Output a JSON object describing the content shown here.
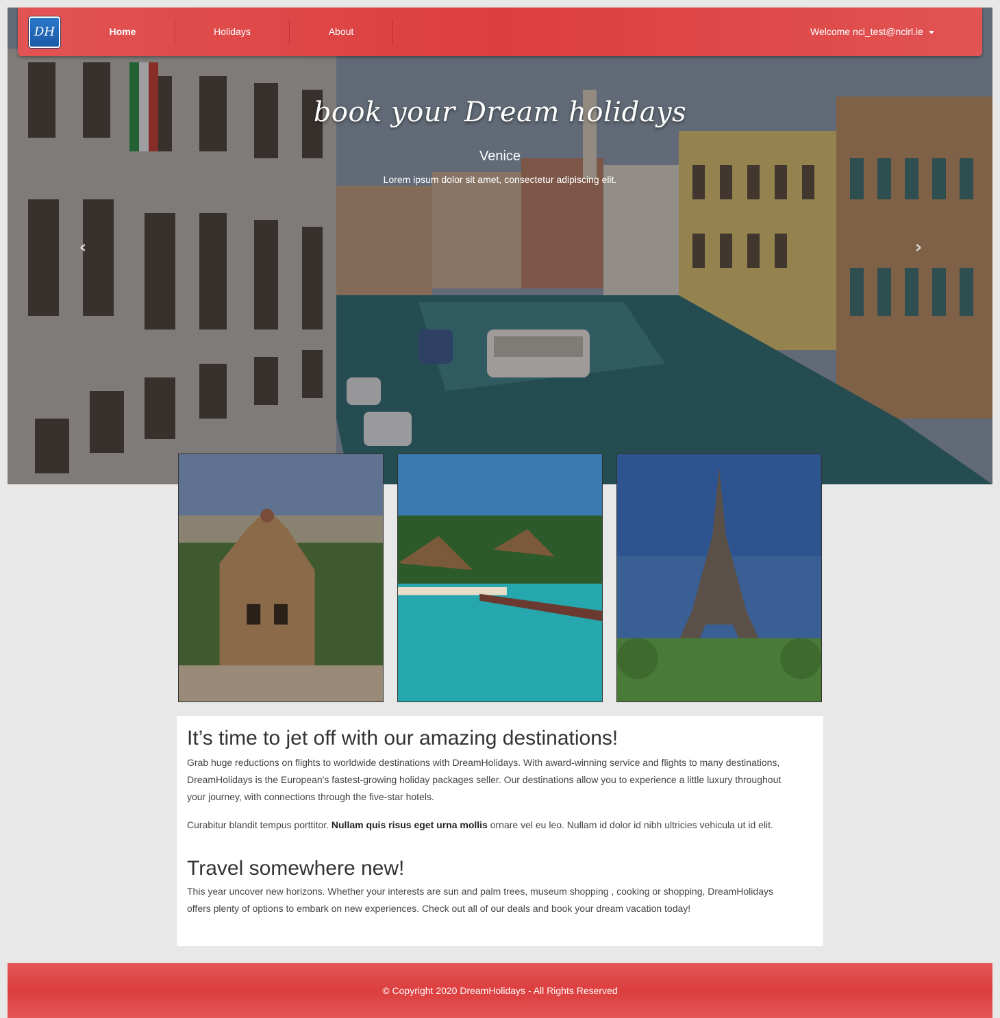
{
  "nav": {
    "brand": "DH",
    "items": [
      {
        "label": "Home",
        "active": true
      },
      {
        "label": "Holidays",
        "active": false
      },
      {
        "label": "About",
        "active": false
      }
    ],
    "user_menu": "Welcome nci_test@ncirl.ie"
  },
  "hero": {
    "title": "book your Dream holidays",
    "subtitle": "Venice",
    "description": "Lorem ipsum dolor sit amet, consectetur adipiscing elit.",
    "prev_icon": "chevron-left-icon",
    "next_icon": "chevron-right-icon"
  },
  "content": {
    "heading1": "It’s time to jet off with our amazing destinations!",
    "para1": "Grab huge reductions on flights to worldwide destinations with DreamHolidays. With award-winning service and flights to many destinations, DreamHolidays is the European's fastest-growing holiday packages seller. Our destinations allow you to experience a little luxury throughout your journey, with connections through the five-star hotels.",
    "para2_start": "Curabitur blandit tempus porttitor. ",
    "para2_bold": "Nullam quis risus eget urna mollis",
    "para2_end": " ornare vel eu leo. Nullam id dolor id nibh ultricies vehicula ut id elit.",
    "heading2": "Travel somewhere new!",
    "para3": "This year uncover new horizons. Whether your interests are sun and palm trees, museum shopping , cooking or shopping, DreamHolidays offers plenty of options to embark on new experiences. Check out all of our deals and book your dream vacation today!"
  },
  "footer": {
    "text": "© Copyright 2020 DreamHolidays - All Rights Reserved"
  },
  "colors": {
    "navbar": "#dc3e3e",
    "brand": "#1b5aa6",
    "page_bg": "#e8e8e8"
  }
}
